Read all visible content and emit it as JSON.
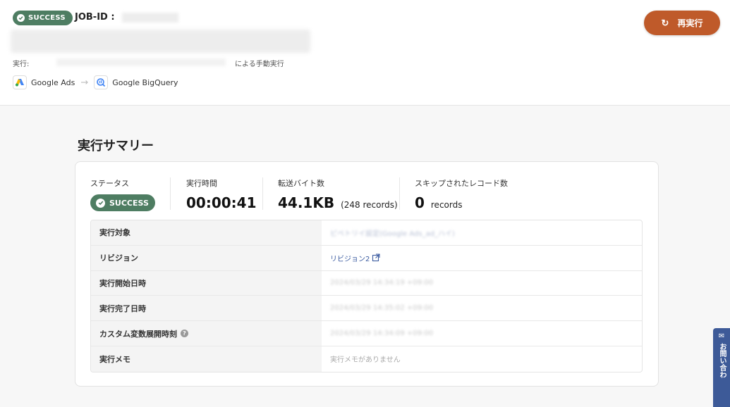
{
  "header": {
    "status": "SUCCESS",
    "job_id_label": "JOB-ID :",
    "exec_prefix": "実行:",
    "exec_suffix": "による手動実行",
    "source": "Google Ads",
    "destination": "Google BigQuery",
    "rerun_label": "再実行"
  },
  "summary": {
    "title": "実行サマリー",
    "metrics": {
      "status_label": "ステータス",
      "status_value": "SUCCESS",
      "duration_label": "実行時間",
      "duration_value": "00:00:41",
      "bytes_label": "転送バイト数",
      "bytes_value": "44.1KB",
      "bytes_records": "(248 records)",
      "skipped_label": "スキップされたレコード数",
      "skipped_value": "0",
      "skipped_unit": "records"
    },
    "rows": [
      {
        "label": "実行対象",
        "value": "ピペトリイ設定(Google Ads_ad_ハイ)"
      },
      {
        "label": "リビジョン",
        "value": "リビジョン2"
      },
      {
        "label": "実行開始日時",
        "value": "2024/03/29 14:34:19 +09:00"
      },
      {
        "label": "実行完了日時",
        "value": "2024/03/29 14:35:02 +09:00"
      },
      {
        "label": "カスタム変数展開時刻",
        "value": "2024/03/29 14:34:09 +09:00"
      },
      {
        "label": "実行メモ",
        "value": "実行メモがありません"
      }
    ]
  },
  "contact_tab": {
    "label": "お問い合わ"
  },
  "colors": {
    "success": "#4e7d62",
    "rerun": "#bf5a2a",
    "link": "#3b5ba0",
    "contact": "#3d5a98"
  }
}
